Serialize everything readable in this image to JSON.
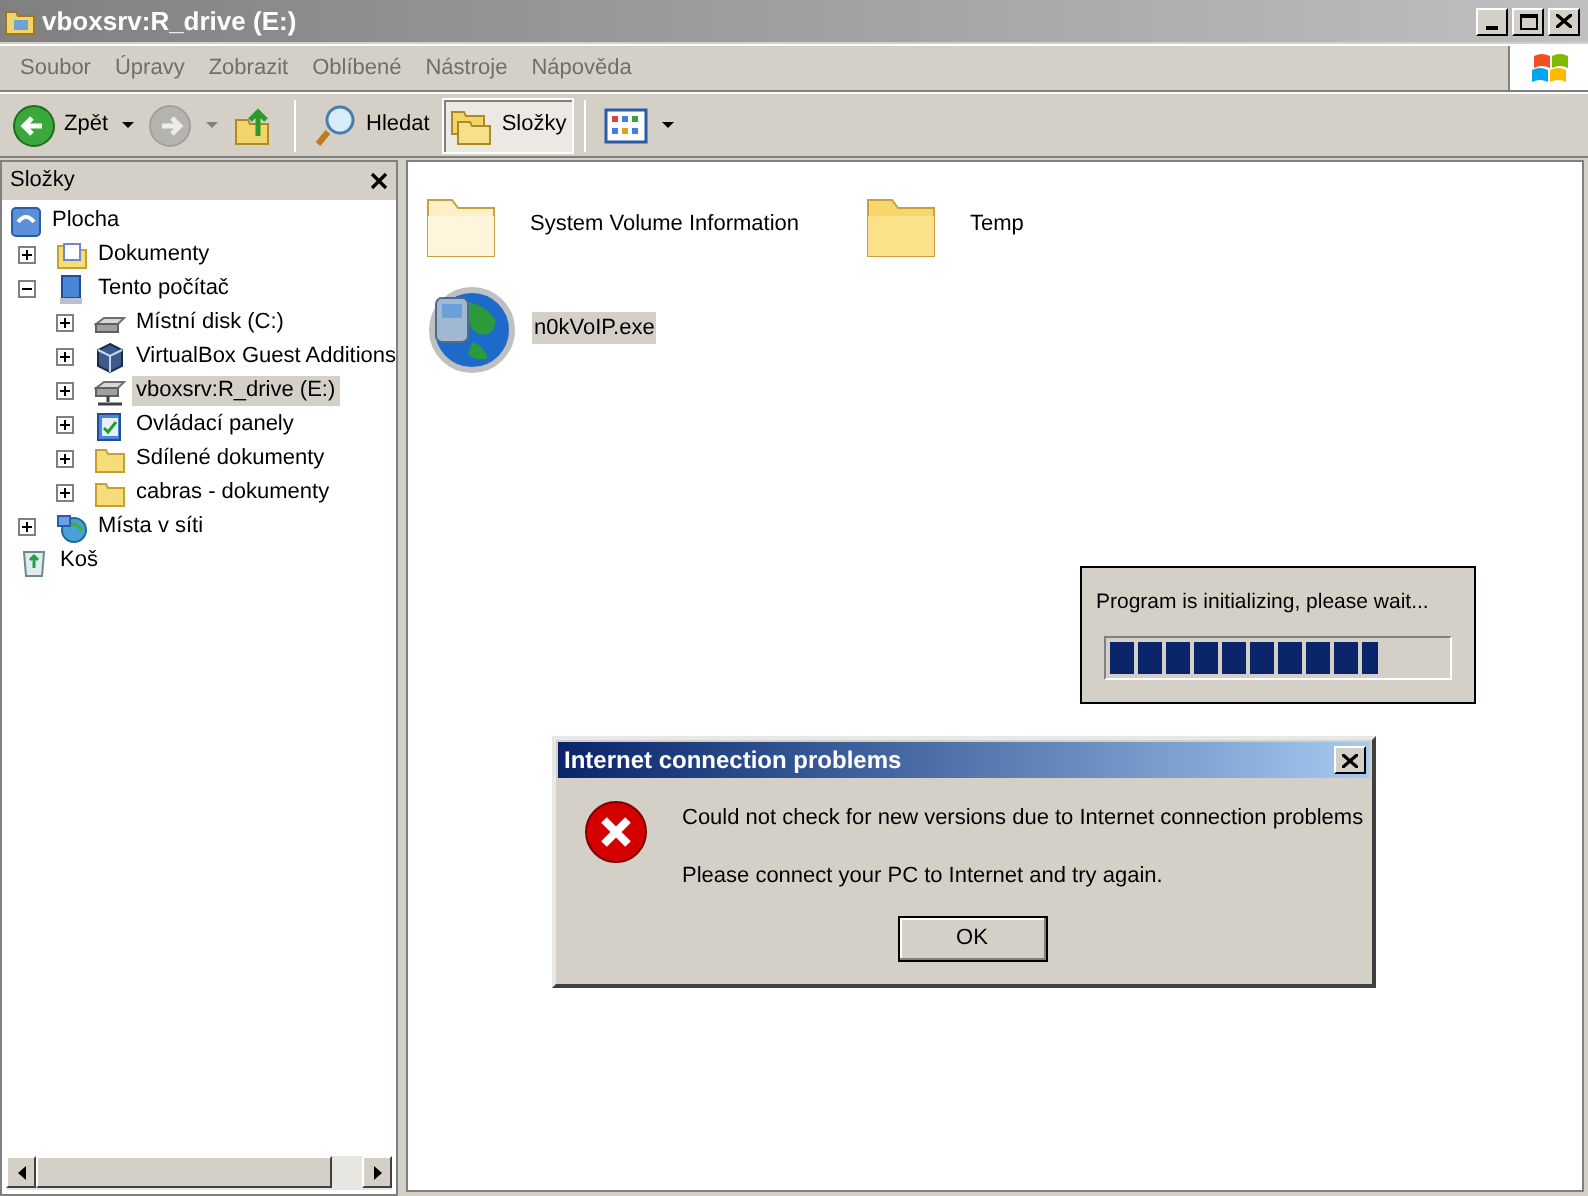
{
  "window": {
    "title": "vboxsrv:R_drive (E:)"
  },
  "menu": [
    "Soubor",
    "Úpravy",
    "Zobrazit",
    "Oblíbené",
    "Nástroje",
    "Nápověda"
  ],
  "toolbar": [
    {
      "kind": "back",
      "label": "Zpět",
      "disabled": false,
      "selected": false
    },
    {
      "kind": "forward",
      "disabled": true,
      "selected": false
    },
    {
      "kind": "up",
      "disabled": false,
      "selected": false
    },
    {
      "kind": "search",
      "label": "Hledat",
      "disabled": false,
      "selected": false
    },
    {
      "kind": "folders",
      "label": "Složky",
      "disabled": false,
      "selected": true
    },
    {
      "kind": "views",
      "disabled": false,
      "selected": false
    }
  ],
  "folders_panel": {
    "title": "Složky",
    "tree": [
      {
        "label": "Plocha",
        "kind": "desktop",
        "selected": false,
        "children": [
          {
            "label": "Dokumenty",
            "kind": "documents",
            "expanded": false,
            "selected": false
          },
          {
            "label": "Tento počítač",
            "kind": "computer",
            "expanded": true,
            "selected": false,
            "children": [
              {
                "label": "Místní disk (C:)",
                "kind": "disk",
                "expanded": false,
                "selected": false
              },
              {
                "label": "VirtualBox Guest Additions",
                "kind": "cube",
                "expanded": false,
                "selected": false
              },
              {
                "label": "vboxsrv:R_drive (E:)",
                "kind": "netdrive",
                "expanded": false,
                "selected": true
              },
              {
                "label": "Ovládací panely",
                "kind": "control",
                "expanded": false,
                "selected": false
              },
              {
                "label": "Sdílené dokumenty",
                "kind": "folder",
                "expanded": false,
                "selected": false
              },
              {
                "label": "cabras - dokumenty",
                "kind": "folder",
                "expanded": false,
                "selected": false
              }
            ]
          },
          {
            "label": "Místa v síti",
            "kind": "network",
            "expanded": false,
            "selected": false
          },
          {
            "label": "Koš",
            "kind": "recycle",
            "selected": false
          }
        ]
      }
    ]
  },
  "files": [
    {
      "name": "System Volume Information",
      "kind": "folder",
      "selected": false
    },
    {
      "name": "Temp",
      "kind": "folder",
      "selected": false
    },
    {
      "name": "n0kVoIP.exe",
      "kind": "app",
      "selected": true
    }
  ],
  "progress_window": {
    "message": "Program is initializing, please wait...",
    "level": 0.8
  },
  "dialog": {
    "title": "Internet connection problems",
    "messages": [
      "Could not check for new versions due to Internet connection problems",
      "Please connect your PC to Internet and try again."
    ],
    "button": "OK"
  }
}
